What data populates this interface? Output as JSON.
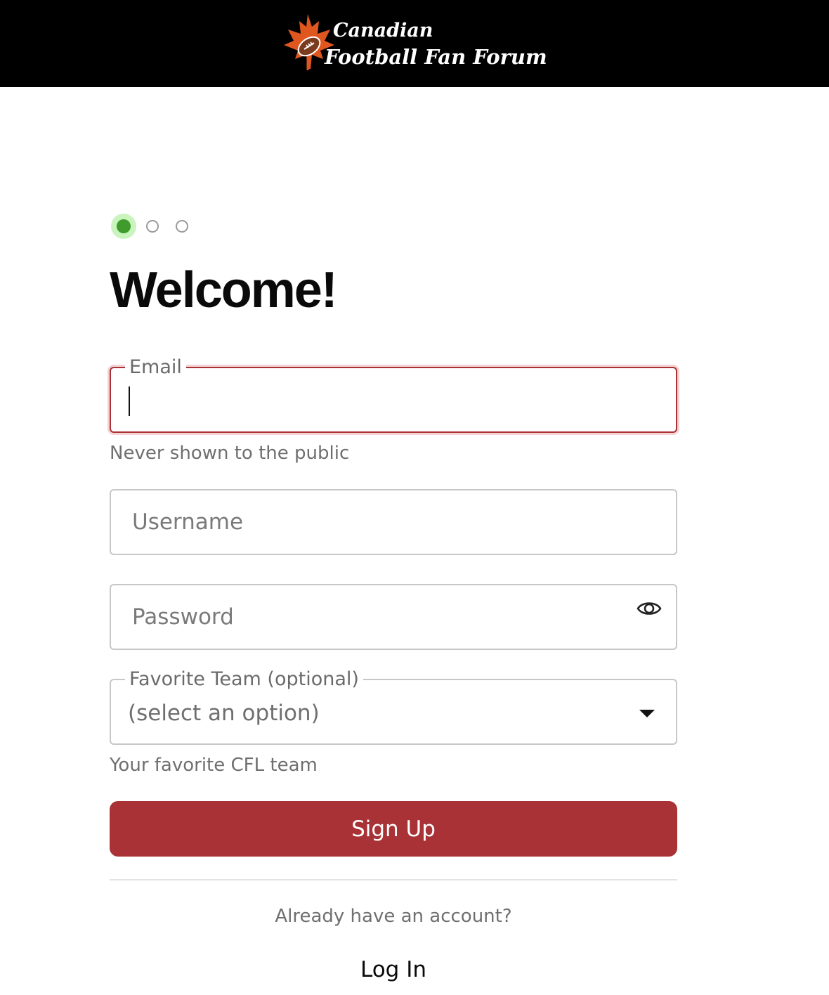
{
  "header": {
    "logo_line1": "Canadian",
    "logo_line2": "Football Fan Forum",
    "logo_icon": "maple-leaf-football-icon",
    "background": "#000000"
  },
  "progress": {
    "total_steps": 3,
    "current_step": 1,
    "active_color": "#3f9b2c"
  },
  "page": {
    "title": "Welcome!"
  },
  "form": {
    "email": {
      "label": "Email",
      "value": "",
      "helper": "Never shown to the public"
    },
    "username": {
      "placeholder": "Username",
      "value": ""
    },
    "password": {
      "placeholder": "Password",
      "value": "",
      "toggle_icon": "eye-icon"
    },
    "team": {
      "label": "Favorite Team (optional)",
      "selected": "(select an option)",
      "helper": "Your favorite CFL team",
      "dropdown_icon": "chevron-down-icon"
    },
    "submit_label": "Sign Up",
    "submit_color": "#a83236"
  },
  "footer": {
    "prompt": "Already have an account?",
    "login_label": "Log In"
  }
}
